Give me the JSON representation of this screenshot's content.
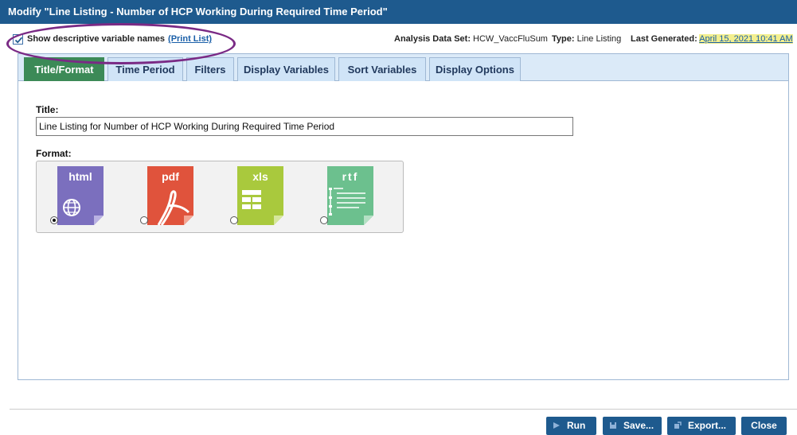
{
  "dialog": {
    "title": "Modify \"Line Listing - Number of HCP Working During Required Time Period\""
  },
  "infobar": {
    "show_descriptive_label": "Show descriptive variable names",
    "print_list_link": "(Print List)",
    "analysis_data_set_label": "Analysis Data Set:",
    "analysis_data_set_value": "HCW_VaccFluSum",
    "type_label": "Type:",
    "type_value": "Line Listing",
    "last_generated_label": "Last Generated:",
    "last_generated_value": "April 15, 2021 10:41 AM"
  },
  "tabs": [
    {
      "label": "Title/Format",
      "active": true
    },
    {
      "label": "Time Period",
      "active": false
    },
    {
      "label": "Filters",
      "active": false
    },
    {
      "label": "Display Variables",
      "active": false
    },
    {
      "label": "Sort Variables",
      "active": false
    },
    {
      "label": "Display Options",
      "active": false
    }
  ],
  "form": {
    "title_label": "Title:",
    "title_value": "Line Listing for Number of HCP Working During Required Time Period",
    "format_label": "Format:",
    "formats": [
      {
        "label": "html",
        "color": "#7b6fbe",
        "selected": true,
        "icon": "globe-icon"
      },
      {
        "label": "pdf",
        "color": "#e0533c",
        "selected": false,
        "icon": "acrobat-icon"
      },
      {
        "label": "xls",
        "color": "#a9c93d",
        "selected": false,
        "icon": "grid-icon"
      },
      {
        "label": "rtf",
        "color": "#6cc08e",
        "selected": false,
        "icon": "lines-icon"
      }
    ]
  },
  "buttons": {
    "run": "Run",
    "save": "Save...",
    "export": "Export...",
    "close": "Close"
  },
  "colors": {
    "header": "#1e5a8e",
    "active_tab": "#3c8a57",
    "tabstrip": "#dbeaf8",
    "annotation": "#7a2a85"
  }
}
